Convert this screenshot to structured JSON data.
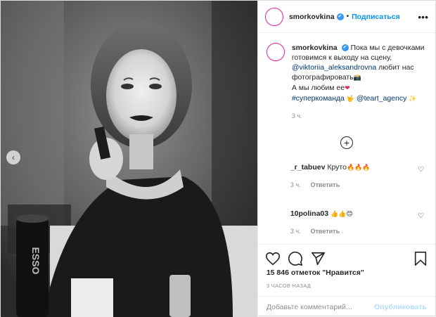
{
  "header": {
    "username": "smorkovkina",
    "verified_glyph": "✔",
    "separator": "•",
    "follow_label": "Подписаться",
    "more_glyph": "•••"
  },
  "caption": {
    "username": "smorkovkina",
    "part1": "Пока мы с девочками готовимся к выходу на сцену,",
    "mention": "@viktoriia_aleksandrovna",
    "part2": "любит нас фотографировать",
    "emoji1": "📸",
    "line2": "А мы любим ее",
    "emoji2": "❤",
    "hashtag": "#суперкоманда",
    "emoji3": "🤟",
    "mention2": "@teart_agency",
    "emoji4": "✨",
    "time": "3 ч."
  },
  "load_more_glyph": "+",
  "comments": [
    {
      "username": "_r_tabuev",
      "text": "Круто",
      "emoji": "🔥🔥🔥",
      "time": "3 ч.",
      "reply_label": "Ответить",
      "like_glyph": "♡"
    },
    {
      "username": "10polina03",
      "text": "",
      "emoji": "👍👍😊",
      "time": "3 ч.",
      "reply_label": "Ответить",
      "like_glyph": "♡"
    }
  ],
  "likes_text": "15 846 отметок \"Нравится\"",
  "timestamp": "3 ЧАСОВ НАЗАД",
  "add_comment": {
    "placeholder": "Добавьте комментарий...",
    "publish_label": "Опубликовать"
  },
  "carousel_prev_glyph": "‹",
  "photo": {
    "brand_text": "ESSO"
  },
  "colors": {
    "accent": "#0095f6",
    "publish_disabled": "#b2dffc",
    "verified": "#3897f0",
    "text": "#262626",
    "muted": "#8e8e8e"
  },
  "icons": [
    "heart-icon",
    "comment-icon",
    "share-icon",
    "bookmark-icon",
    "plus-circle-icon",
    "verified-icon",
    "more-icon"
  ]
}
